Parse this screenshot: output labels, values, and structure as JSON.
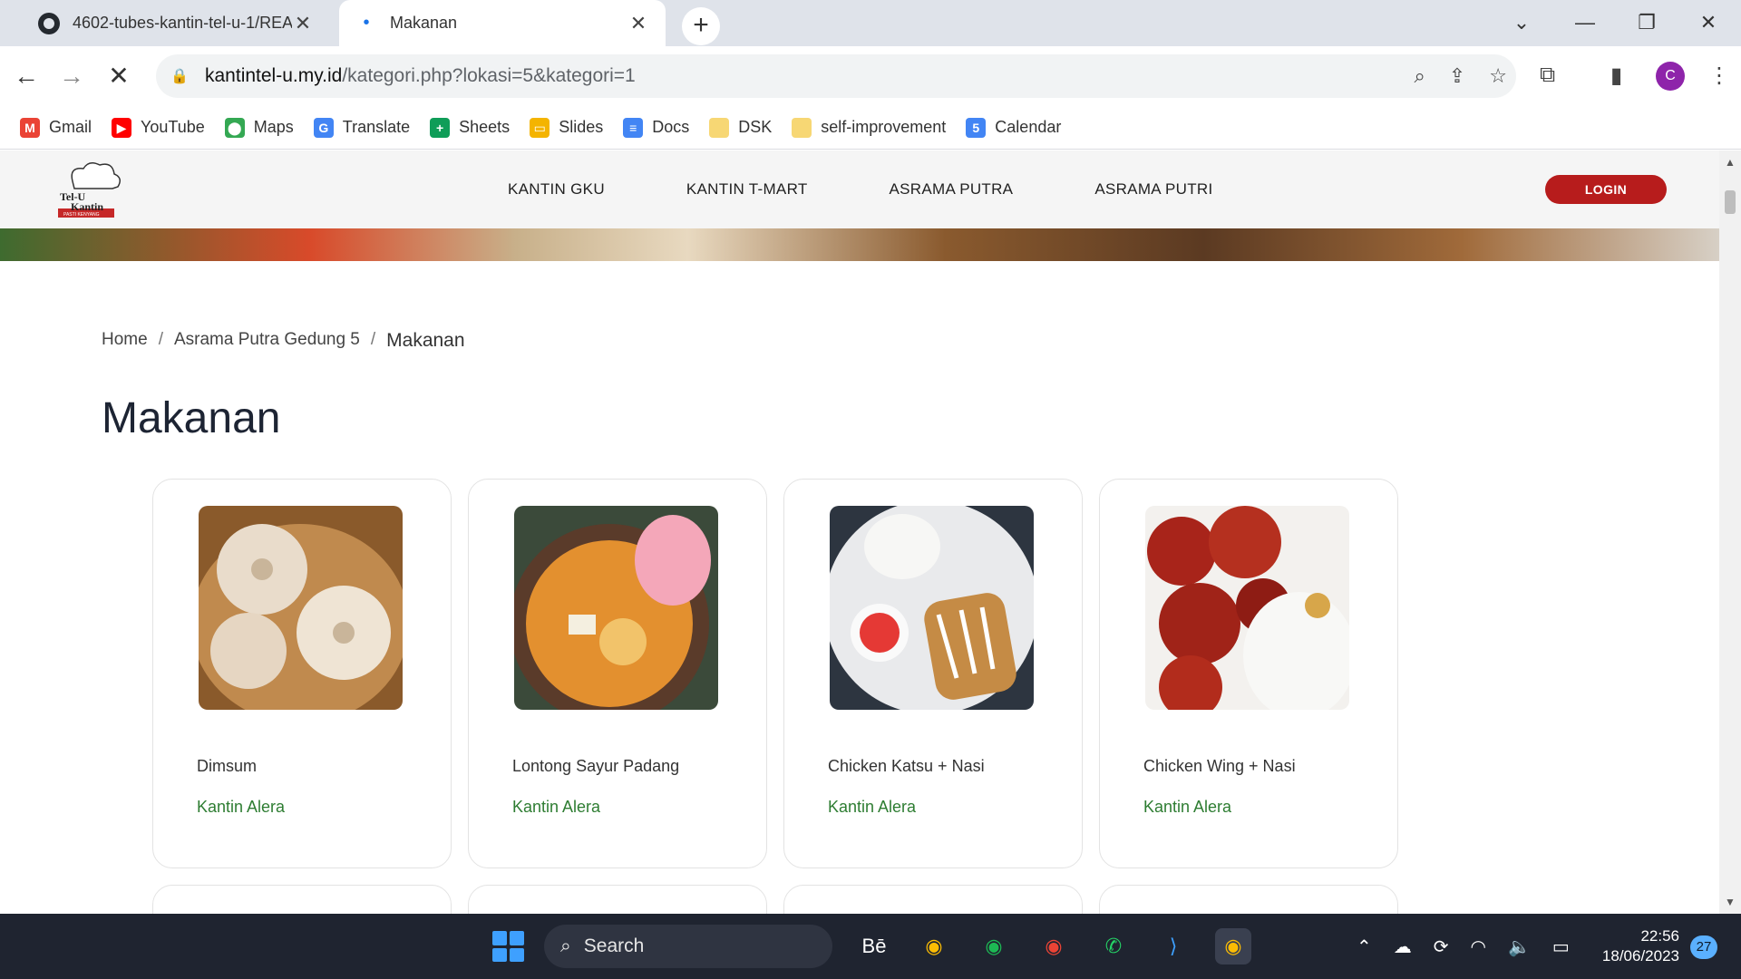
{
  "browser": {
    "tabs": [
      {
        "title": "4602-tubes-kantin-tel-u-1/REA",
        "close": "✕"
      },
      {
        "title": "Makanan",
        "close": "✕"
      }
    ],
    "new_tab": "+",
    "url": {
      "host": "kantintel-u.my.id",
      "path": "/kategori.php?lokasi=5&kategori=1"
    },
    "profile_initial": "C",
    "bookmarks": [
      {
        "label": "Gmail",
        "icon": "gmail-icon",
        "color": "#ea4335",
        "glyph": "M"
      },
      {
        "label": "YouTube",
        "icon": "youtube-icon",
        "color": "#ff0000",
        "glyph": "▶"
      },
      {
        "label": "Maps",
        "icon": "maps-icon",
        "color": "#34a853",
        "glyph": "⬤"
      },
      {
        "label": "Translate",
        "icon": "translate-icon",
        "color": "#4285f4",
        "glyph": "G"
      },
      {
        "label": "Sheets",
        "icon": "sheets-icon",
        "color": "#0f9d58",
        "glyph": "+"
      },
      {
        "label": "Slides",
        "icon": "slides-icon",
        "color": "#f4b400",
        "glyph": "▭"
      },
      {
        "label": "Docs",
        "icon": "docs-icon",
        "color": "#4285f4",
        "glyph": "≡"
      },
      {
        "label": "DSK",
        "icon": "folder-icon",
        "color": "#f7d774",
        "glyph": ""
      },
      {
        "label": "self-improvement",
        "icon": "folder-icon",
        "color": "#f7d774",
        "glyph": ""
      },
      {
        "label": "Calendar",
        "icon": "calendar-icon",
        "color": "#4285f4",
        "glyph": "5"
      }
    ]
  },
  "site": {
    "logo_text": {
      "line1": "Tel-U",
      "line2": "Kantin",
      "tagline": "PASTI KENYANG"
    },
    "nav": [
      "KANTIN GKU",
      "KANTIN T-MART",
      "ASRAMA PUTRA",
      "ASRAMA PUTRI"
    ],
    "login": "LOGIN",
    "breadcrumb": {
      "home": "Home",
      "location": "Asrama Putra Gedung 5",
      "current": "Makanan",
      "separator": "/"
    },
    "title": "Makanan",
    "products": [
      {
        "name": "Dimsum",
        "canteen": "Kantin Alera"
      },
      {
        "name": "Lontong Sayur Padang",
        "canteen": "Kantin Alera"
      },
      {
        "name": "Chicken Katsu + Nasi",
        "canteen": "Kantin Alera"
      },
      {
        "name": "Chicken Wing + Nasi",
        "canteen": "Kantin Alera"
      }
    ]
  },
  "taskbar": {
    "search": "Search",
    "time": "22:56",
    "date": "18/06/2023",
    "notifications": "27"
  },
  "colors": {
    "accent_red": "#b71c1c",
    "canteen_green": "#2e7d32"
  }
}
